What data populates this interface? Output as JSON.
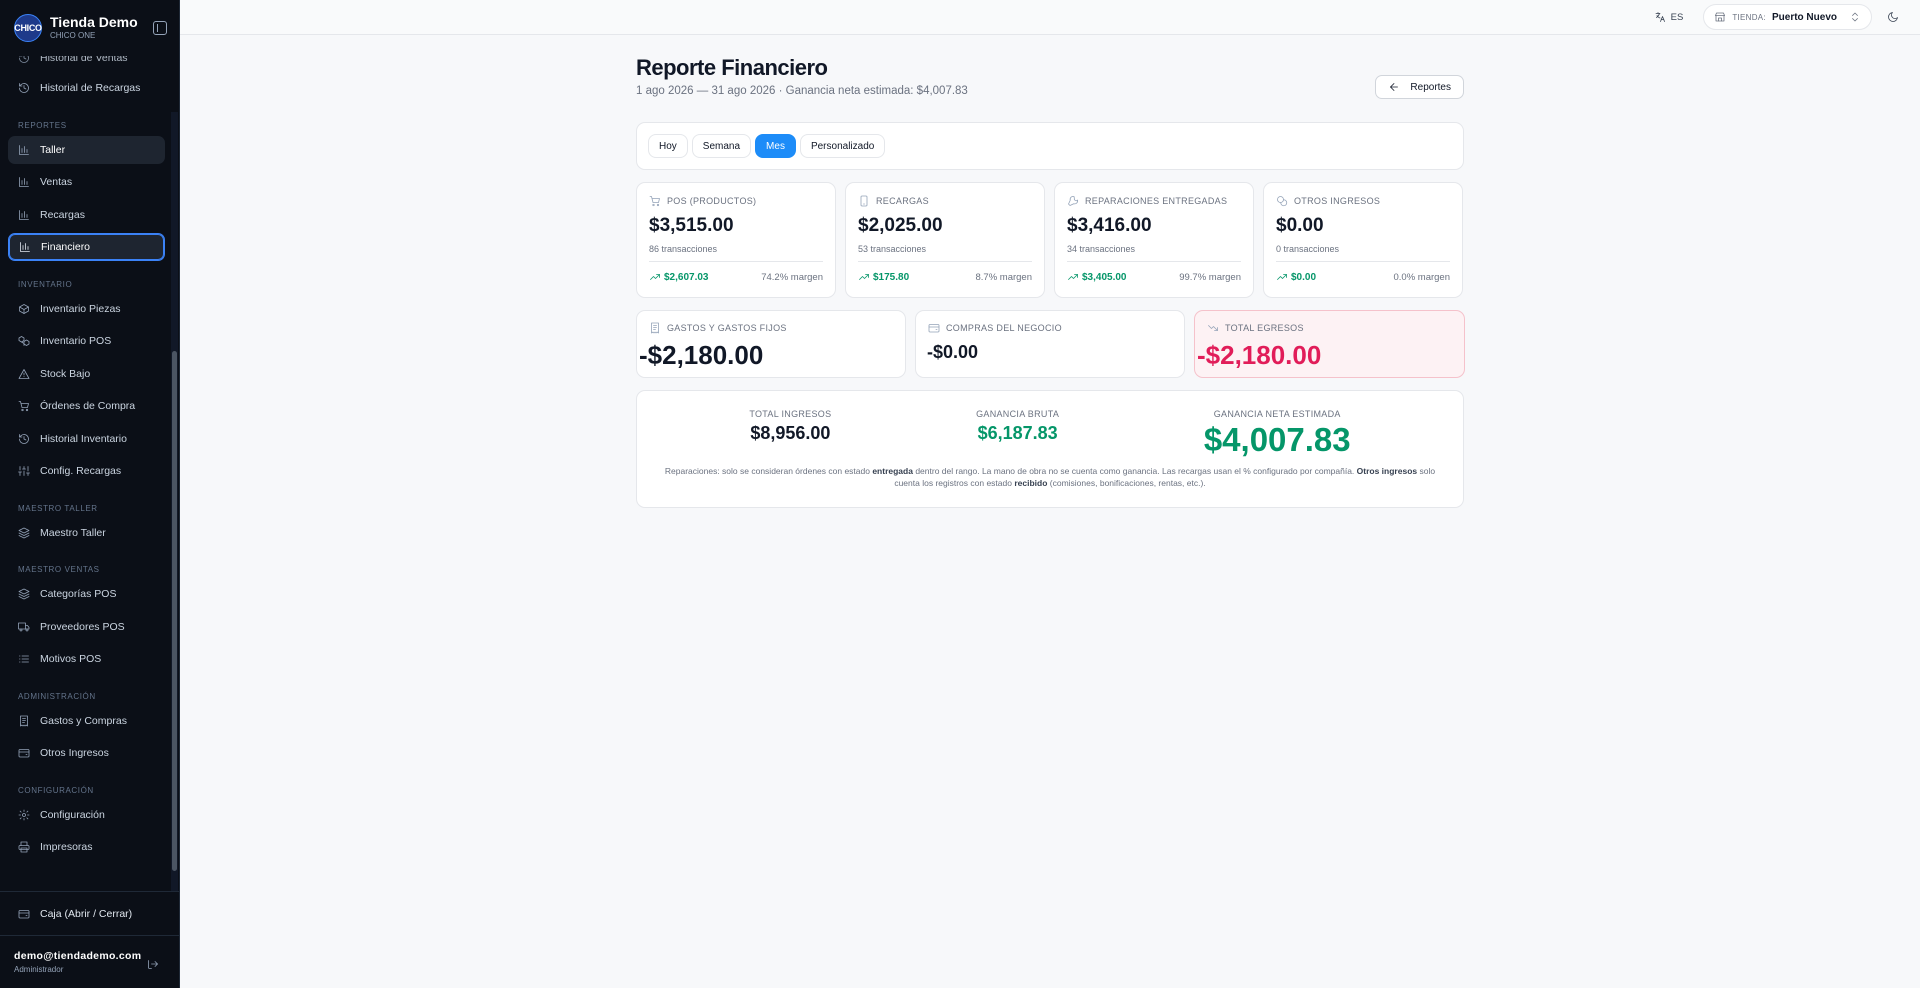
{
  "brand": {
    "logo": "CHICO",
    "name": "Tienda Demo",
    "sub": "CHICO ONE"
  },
  "sidebar": {
    "partial_top": "Historial de Ventas",
    "top_items": [
      {
        "label": "Historial de Recargas",
        "icon": "history-icon"
      }
    ],
    "sections": [
      {
        "title": "REPORTES",
        "items": [
          {
            "label": "Taller",
            "icon": "bar-chart-icon"
          },
          {
            "label": "Ventas",
            "icon": "bar-chart-icon"
          },
          {
            "label": "Recargas",
            "icon": "bar-chart-icon"
          },
          {
            "label": "Financiero",
            "icon": "bar-chart-icon"
          }
        ]
      },
      {
        "title": "INVENTARIO",
        "items": [
          {
            "label": "Inventario Piezas",
            "icon": "package-icon"
          },
          {
            "label": "Inventario POS",
            "icon": "boxes-icon"
          },
          {
            "label": "Stock Bajo",
            "icon": "warning-icon"
          },
          {
            "label": "Órdenes de Compra",
            "icon": "cart-icon"
          },
          {
            "label": "Historial Inventario",
            "icon": "history-icon"
          },
          {
            "label": "Config. Recargas",
            "icon": "sliders-icon"
          }
        ]
      },
      {
        "title": "MAESTRO TALLER",
        "items": [
          {
            "label": "Maestro Taller",
            "icon": "layers-icon"
          }
        ]
      },
      {
        "title": "MAESTRO VENTAS",
        "items": [
          {
            "label": "Categorías POS",
            "icon": "layers-icon"
          },
          {
            "label": "Proveedores POS",
            "icon": "truck-icon"
          },
          {
            "label": "Motivos POS",
            "icon": "list-icon"
          }
        ]
      },
      {
        "title": "ADMINISTRACIÓN",
        "items": [
          {
            "label": "Gastos y Compras",
            "icon": "receipt-icon"
          },
          {
            "label": "Otros Ingresos",
            "icon": "wallet-icon"
          }
        ]
      },
      {
        "title": "CONFIGURACIÓN",
        "items": [
          {
            "label": "Configuración",
            "icon": "gear-icon"
          },
          {
            "label": "Impresoras",
            "icon": "printer-icon"
          }
        ]
      }
    ],
    "caja": "Caja (Abrir / Cerrar)",
    "user_email": "demo@tiendademo.com",
    "user_role": "Administrador"
  },
  "topbar": {
    "lang": "ES",
    "store_label": "TIENDA:",
    "store_name": "Puerto Nuevo"
  },
  "page": {
    "title": "Reporte Financiero",
    "subtitle": "1 ago 2026 — 31 ago 2026 · Ganancia neta estimada: $4,007.83",
    "back_label": "Reportes",
    "ranges": [
      "Hoy",
      "Semana",
      "Mes",
      "Personalizado"
    ],
    "active_range": "Mes"
  },
  "kpis": [
    {
      "label": "POS (PRODUCTOS)",
      "icon": "cart-icon",
      "value": "$3,515.00",
      "sub": "86 transacciones",
      "profit": "$2,607.03",
      "margin": "74.2% margen"
    },
    {
      "label": "RECARGAS",
      "icon": "phone-icon",
      "value": "$2,025.00",
      "sub": "53 transacciones",
      "profit": "$175.80",
      "margin": "8.7% margen"
    },
    {
      "label": "REPARACIONES ENTREGADAS",
      "icon": "wrench-icon",
      "value": "$3,416.00",
      "sub": "34 transacciones",
      "profit": "$3,405.00",
      "margin": "99.7% margen"
    },
    {
      "label": "OTROS INGRESOS",
      "icon": "coins-icon",
      "value": "$0.00",
      "sub": "0 transacciones",
      "profit": "$0.00",
      "margin": "0.0% margen"
    }
  ],
  "expenses": [
    {
      "label": "GASTOS Y GASTOS FIJOS",
      "icon": "receipt-icon",
      "value": "-$2,180.00"
    },
    {
      "label": "COMPRAS DEL NEGOCIO",
      "icon": "wallet-icon",
      "value": "-$0.00"
    },
    {
      "label": "TOTAL EGRESOS",
      "icon": "trending-down-icon",
      "value": "-$2,180.00"
    }
  ],
  "summary": {
    "income_label": "TOTAL INGRESOS",
    "income": "$8,956.00",
    "gross_label": "GANANCIA BRUTA",
    "gross": "$6,187.83",
    "net_label": "GANANCIA NETA ESTIMADA",
    "net": "$4,007.83",
    "note_a": "Reparaciones: solo se consideran órdenes con estado ",
    "note_b": "entregada",
    "note_c": " dentro del rango. La mano de obra no se cuenta como ganancia. Las recargas usan el % configurado por compañía. ",
    "note_d": "Otros ingresos",
    "note_e": " solo cuenta los registros con estado ",
    "note_f": "recibido",
    "note_g": " (comisiones, bonificaciones, rentas, etc.)."
  },
  "colors": {
    "accent": "#1d8cf8",
    "positive": "#059669",
    "negative": "#e11d59",
    "sidebar_bg": "#0b0f17"
  }
}
